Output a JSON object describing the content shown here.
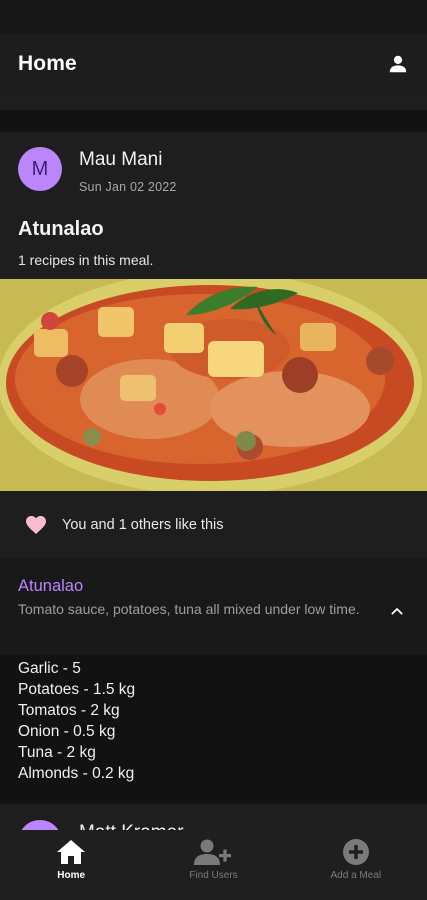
{
  "app_bar": {
    "title": "Home",
    "profile_icon": "person-icon"
  },
  "post": {
    "author": {
      "initial": "M",
      "name": "Mau Mani"
    },
    "date": "Sun Jan 02 2022",
    "meal_title": "Atunalao",
    "recipe_count_text": "1 recipes in this meal.",
    "likes_text": "You and 1 others like this",
    "recipe": {
      "name": "Atunalao",
      "description": "Tomato sauce, potatoes, tuna all mixed under low time.",
      "ingredients": [
        "Garlic - 5",
        "Potatoes - 1.5 kg",
        "Tomatos - 2 kg",
        "Onion - 0.5 kg",
        "Tuna - 2 kg",
        "Almonds - 0.2 kg"
      ]
    }
  },
  "next_post": {
    "author_name": "Matt Kramer"
  },
  "nav": {
    "home": "Home",
    "find_users": "Find Users",
    "add_meal": "Add a Meal"
  },
  "colors": {
    "accent": "#bb86fc",
    "heart": "#f8bbd0",
    "surface": "#1e1e1e",
    "background": "#121212"
  }
}
